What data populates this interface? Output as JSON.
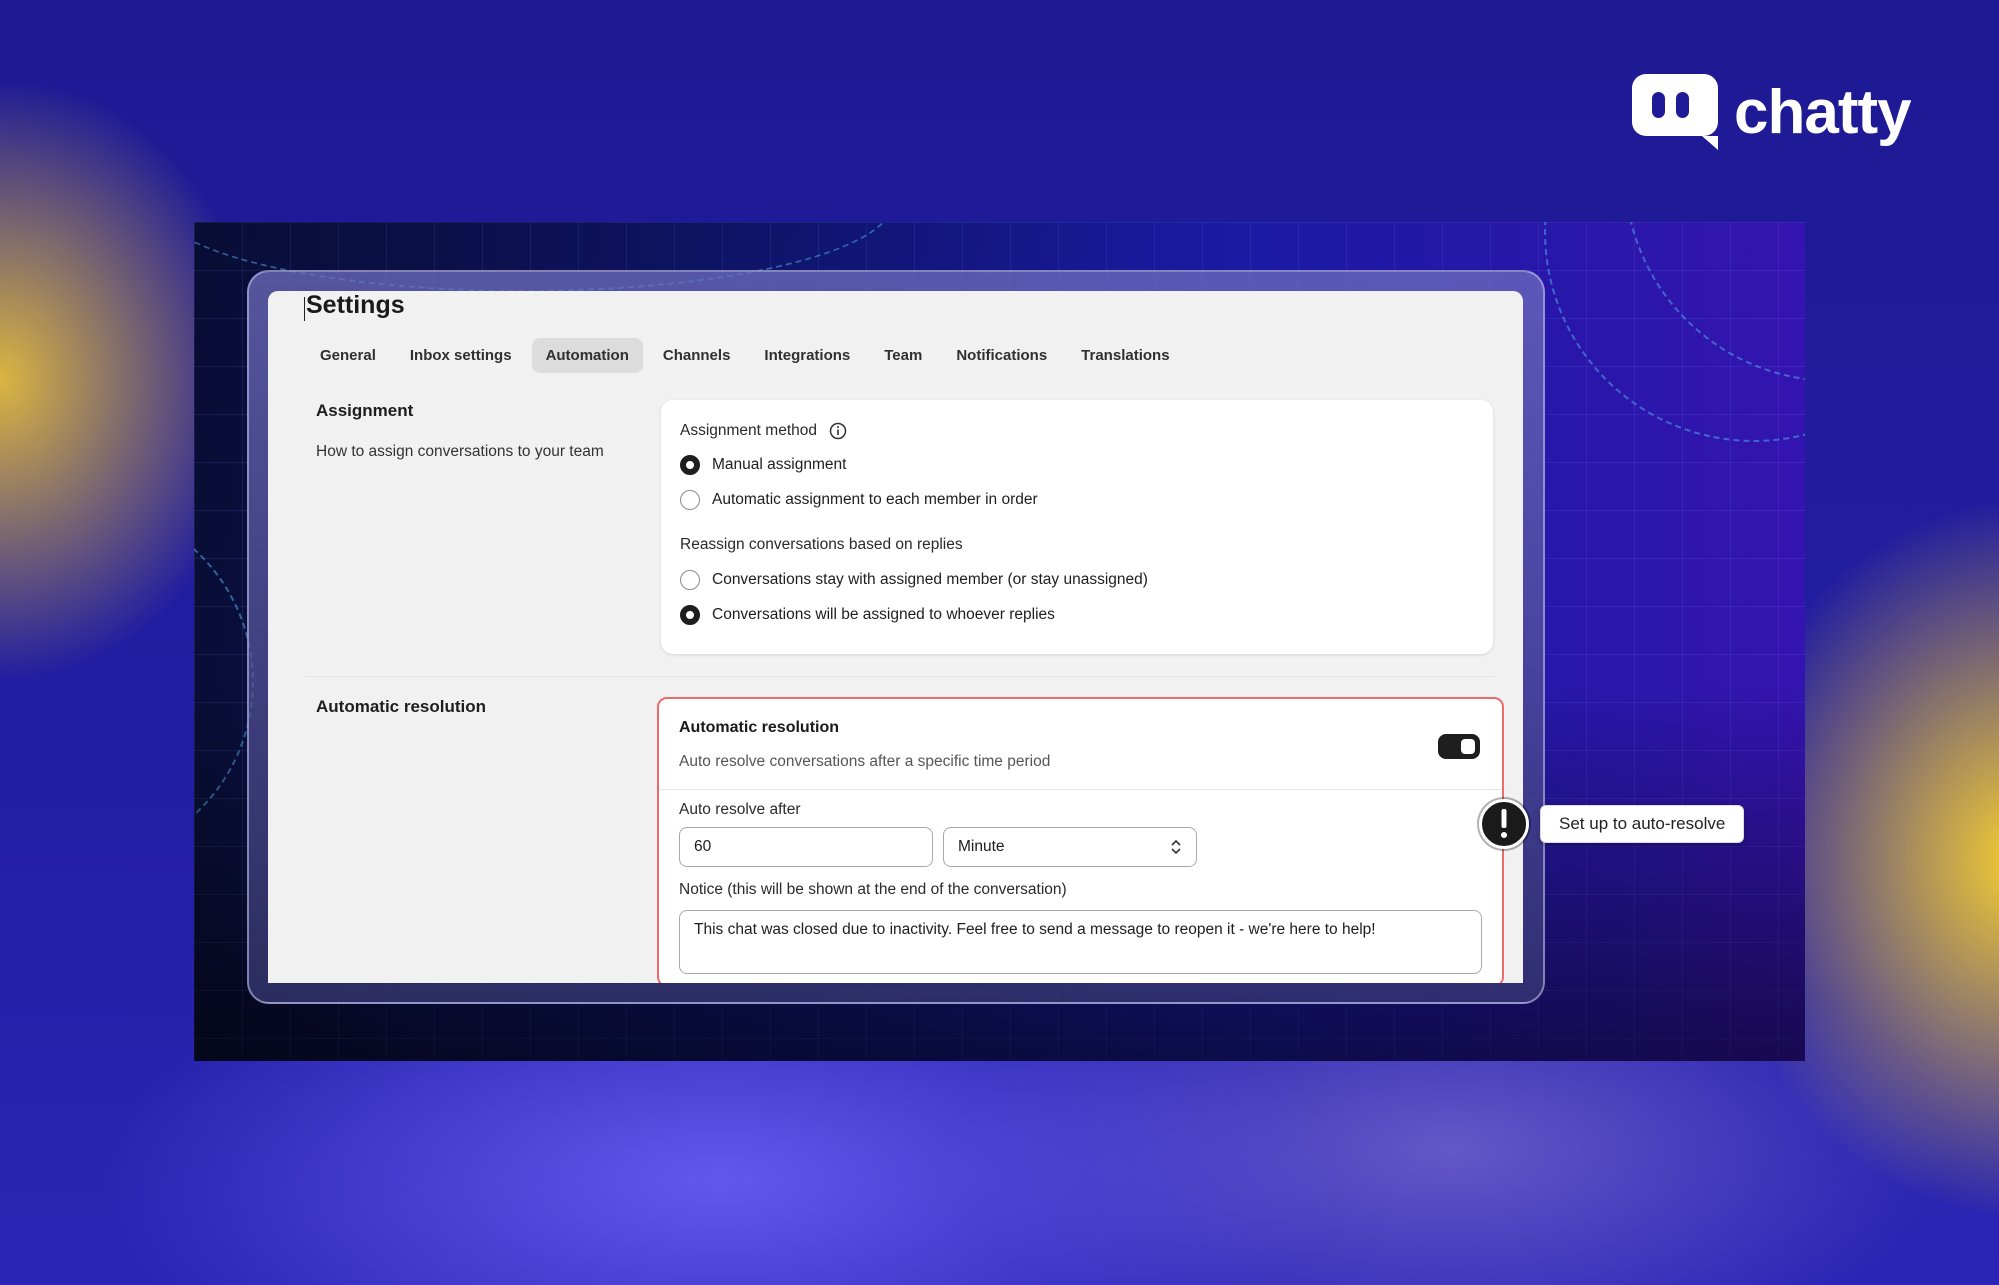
{
  "brand": {
    "name": "chatty"
  },
  "settings": {
    "title": "Settings",
    "tabs": [
      {
        "label": "General",
        "active": false
      },
      {
        "label": "Inbox settings",
        "active": false
      },
      {
        "label": "Automation",
        "active": true
      },
      {
        "label": "Channels",
        "active": false
      },
      {
        "label": "Integrations",
        "active": false
      },
      {
        "label": "Team",
        "active": false
      },
      {
        "label": "Notifications",
        "active": false
      },
      {
        "label": "Translations",
        "active": false
      }
    ]
  },
  "assignment": {
    "section_title": "Assignment",
    "section_desc": "How to assign conversations to your team",
    "method_label": "Assignment method",
    "method_options": [
      {
        "label": "Manual assignment",
        "selected": true
      },
      {
        "label": "Automatic assignment to each member in order",
        "selected": false
      }
    ],
    "reassign_label": "Reassign conversations based on replies",
    "reassign_options": [
      {
        "label": "Conversations stay with assigned member (or stay unassigned)",
        "selected": false
      },
      {
        "label": "Conversations will be assigned to whoever replies",
        "selected": true
      }
    ]
  },
  "auto_resolution": {
    "section_title": "Automatic resolution",
    "card_title": "Automatic resolution",
    "card_desc": "Auto resolve conversations after a specific time period",
    "enabled": true,
    "resolve_after_label": "Auto resolve after",
    "resolve_after_value": "60",
    "unit_value": "Minute",
    "notice_label": "Notice (this will be shown at the end of the conversation)",
    "notice_value": "This chat was closed due to inactivity. Feel free to send a message to reopen it - we're here to help!"
  },
  "callout": {
    "text": "Set up to auto-resolve"
  },
  "colors": {
    "background": "#1f1a97",
    "highlight_border": "#ee6b6b",
    "accent_yellow": "#f5cd32"
  }
}
